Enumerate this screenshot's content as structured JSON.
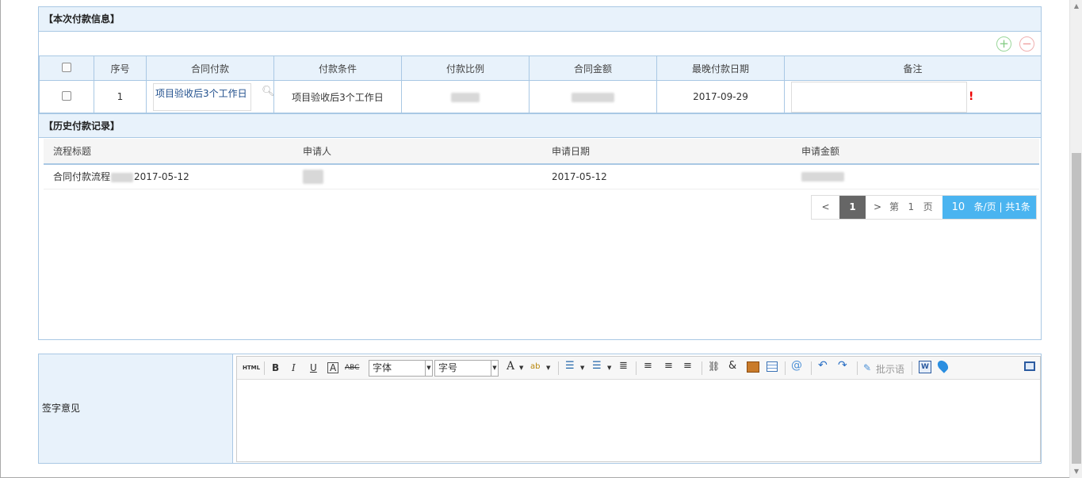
{
  "current_payment": {
    "section_title": "【本次付款信息】",
    "columns": [
      "序号",
      "合同付款",
      "付款条件",
      "付款比例",
      "合同金额",
      "最晚付款日期",
      "备注"
    ],
    "rows": [
      {
        "index": "1",
        "contract_payment": "项目验收后3个工作日",
        "payment_condition": "项目验收后3个工作日",
        "payment_ratio": "",
        "contract_amount": "",
        "latest_date": "2017-09-29",
        "remark": ""
      }
    ],
    "add_icon": "plus-circle-icon",
    "remove_icon": "minus-circle-icon",
    "search_icon": "magnifier-icon",
    "required_mark": "!"
  },
  "history": {
    "section_title": "【历史付款记录】",
    "columns": [
      "流程标题",
      "申请人",
      "申请日期",
      "申请金额"
    ],
    "rows": [
      {
        "title_prefix": "合同付款流程",
        "title_suffix": "2017-05-12",
        "applicant": "",
        "apply_date": "2017-05-12",
        "amount": ""
      }
    ],
    "pager": {
      "prev": "<",
      "current": "1",
      "next": ">",
      "page_label_pre": "第",
      "page_num": "1",
      "page_label_post": "页",
      "page_size": "10",
      "size_label": "条/页",
      "total_label": "共1条"
    }
  },
  "opinion": {
    "label": "签字意见",
    "toolbar": {
      "html": "HTML",
      "bold": "B",
      "italic": "I",
      "underline": "U",
      "font_family": "字体",
      "font_size": "字号",
      "font_color": "A",
      "highlight": "ab",
      "approve_phrase": "批示语"
    }
  },
  "colors": {
    "header_bg": "#e8f2fb",
    "border": "#a9c8e4",
    "pager_active": "#666666",
    "pager_size": "#4ab4f0"
  }
}
